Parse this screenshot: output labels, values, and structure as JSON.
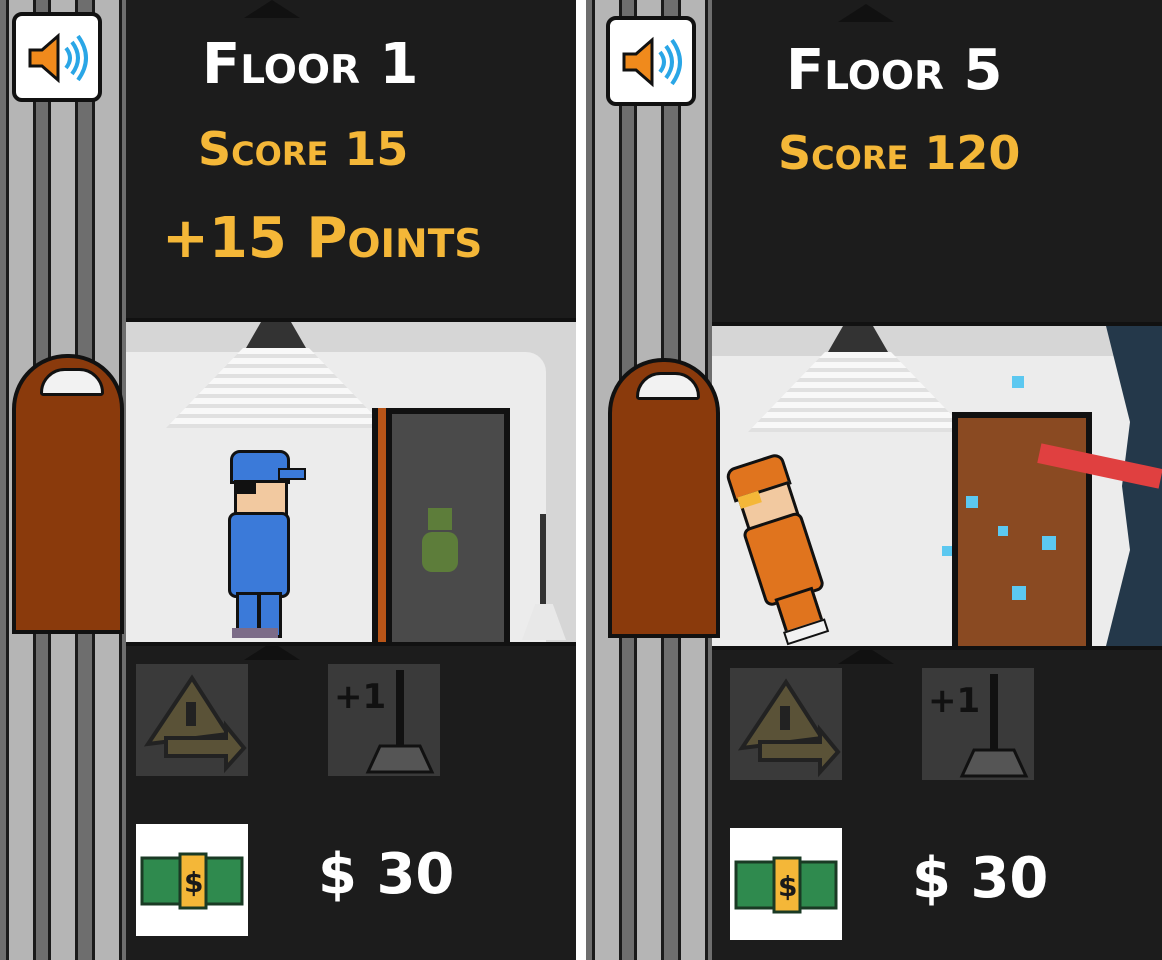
{
  "panels": [
    {
      "floor": "Floor 1",
      "score": "Score 15",
      "points_popup": "+15 Points",
      "money": "$ 30",
      "player_color": "#3b7ad9"
    },
    {
      "floor": "Floor 5",
      "score": "Score 120",
      "points_popup": "",
      "money": "$ 30",
      "player_color": "#e0741e"
    }
  ],
  "icons": {
    "sound": "speaker-icon",
    "ability_1": "warning-sign-icon",
    "ability_2": "plus-one-mop-icon",
    "money": "cash-icon"
  },
  "colors": {
    "score": "#f4b738",
    "background": "#1c1c1c",
    "elevator_door": "#8a3a0c"
  }
}
